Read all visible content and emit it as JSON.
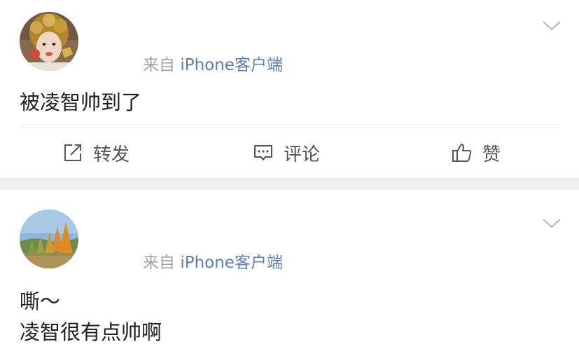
{
  "posts": [
    {
      "source_prefix": "来自 ",
      "source_client": "iPhone客户端",
      "content_lines": [
        "被凌智帅到了"
      ],
      "actions": {
        "repost_label": "转发",
        "comment_label": "评论",
        "like_label": "赞"
      },
      "avatar_icon": "avatar-girl-photo"
    },
    {
      "source_prefix": "来自 ",
      "source_client": "iPhone客户端",
      "content_lines": [
        "嘶～",
        "凌智很有点帅啊"
      ],
      "avatar_icon": "avatar-autumn-trees-photo"
    }
  ],
  "colors": {
    "link": "#5b7fac",
    "muted": "#a2a2a2",
    "separator": "#efefef"
  },
  "icons": {
    "expand": "chevron-down-icon",
    "repost": "repost-icon",
    "comment": "comment-icon",
    "like": "thumbs-up-icon"
  }
}
